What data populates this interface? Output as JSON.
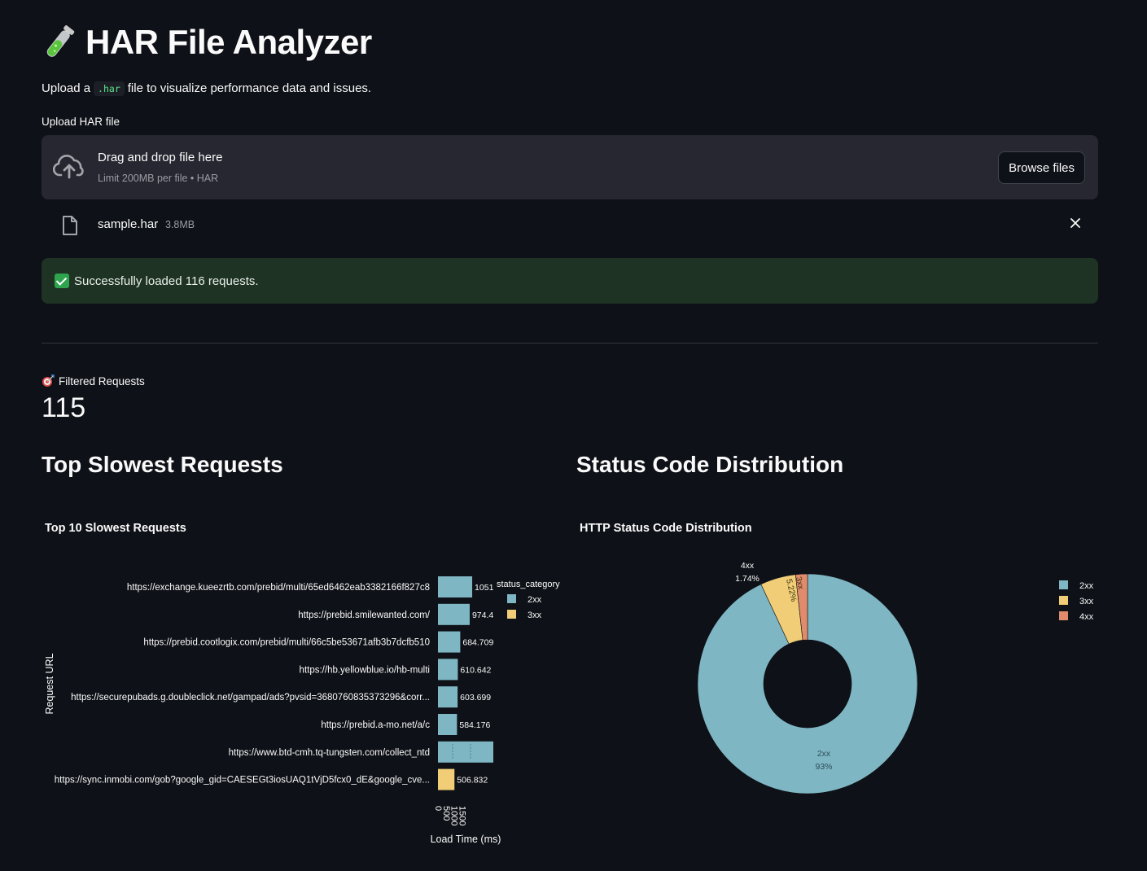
{
  "header": {
    "title": "HAR File Analyzer",
    "subtitle_before": "Upload a",
    "subtitle_code": ".har",
    "subtitle_after": "file to visualize performance data and issues."
  },
  "uploader": {
    "label": "Upload HAR file",
    "drop_text": "Drag and drop file here",
    "limit_text": "Limit 200MB per file • HAR",
    "browse_label": "Browse files"
  },
  "file": {
    "name": "sample.har",
    "size": "3.8MB"
  },
  "alert": {
    "text": "Successfully loaded 116 requests."
  },
  "metric": {
    "label": "Filtered Requests",
    "value": "115"
  },
  "sections": {
    "left_heading": "Top Slowest Requests",
    "right_heading": "Status Code Distribution"
  },
  "chart_data": [
    {
      "type": "bar",
      "orientation": "horizontal",
      "title": "Top 10 Slowest Requests",
      "xlabel": "Load Time (ms)",
      "ylabel": "Request URL",
      "xlim": [
        0,
        1800
      ],
      "xticks": [
        "0",
        "500",
        "1000",
        "1500"
      ],
      "legend": {
        "title": "status_category",
        "entries": [
          "2xx",
          "3xx"
        ],
        "colors": [
          "#7fb6c3",
          "#f0cd76"
        ],
        "placement": "top-right"
      },
      "categories": [
        "https://exchange.kueezrtb.com/prebid/multi/65ed6462eab3382166f827c8",
        "https://prebid.smilewanted.com/",
        "https://prebid.cootlogix.com/prebid/multi/66c5be53671afb3b7dcfb510",
        "https://hb.yellowblue.io/hb-multi",
        "https://securepubads.g.doubleclick.net/gampad/ads?pvsid=3680760835373296&corr...",
        "https://prebid.a-mo.net/a/c",
        "https://www.btd-cmh.tq-tungsten.com/collect_ntd",
        "https://sync.inmobi.com/gob?google_gid=CAESEGt3iosUAQ1tVjD5fcx0_dE&google_cve..."
      ],
      "values": [
        1051.3,
        974.4,
        684.709,
        610.642,
        603.699,
        584.176,
        1700,
        506.832
      ],
      "labels": [
        "1051.",
        "974.4",
        "684.709",
        "610.642",
        "603.699",
        "584.176",
        "",
        "506.832"
      ],
      "status": [
        "2xx",
        "2xx",
        "2xx",
        "2xx",
        "2xx",
        "2xx",
        "2xx",
        "3xx"
      ]
    },
    {
      "type": "pie",
      "hole": true,
      "title": "HTTP Status Code Distribution",
      "labels": [
        "2xx",
        "3xx",
        "4xx"
      ],
      "values": [
        93.04,
        5.22,
        1.74
      ],
      "label_texts": [
        "93%",
        "5.22%",
        "1.74%"
      ],
      "colors": [
        "#7fb6c3",
        "#f0cd76",
        "#e08b6b"
      ],
      "legend": {
        "placement": "right",
        "entries": [
          "2xx",
          "3xx",
          "4xx"
        ]
      }
    }
  ]
}
